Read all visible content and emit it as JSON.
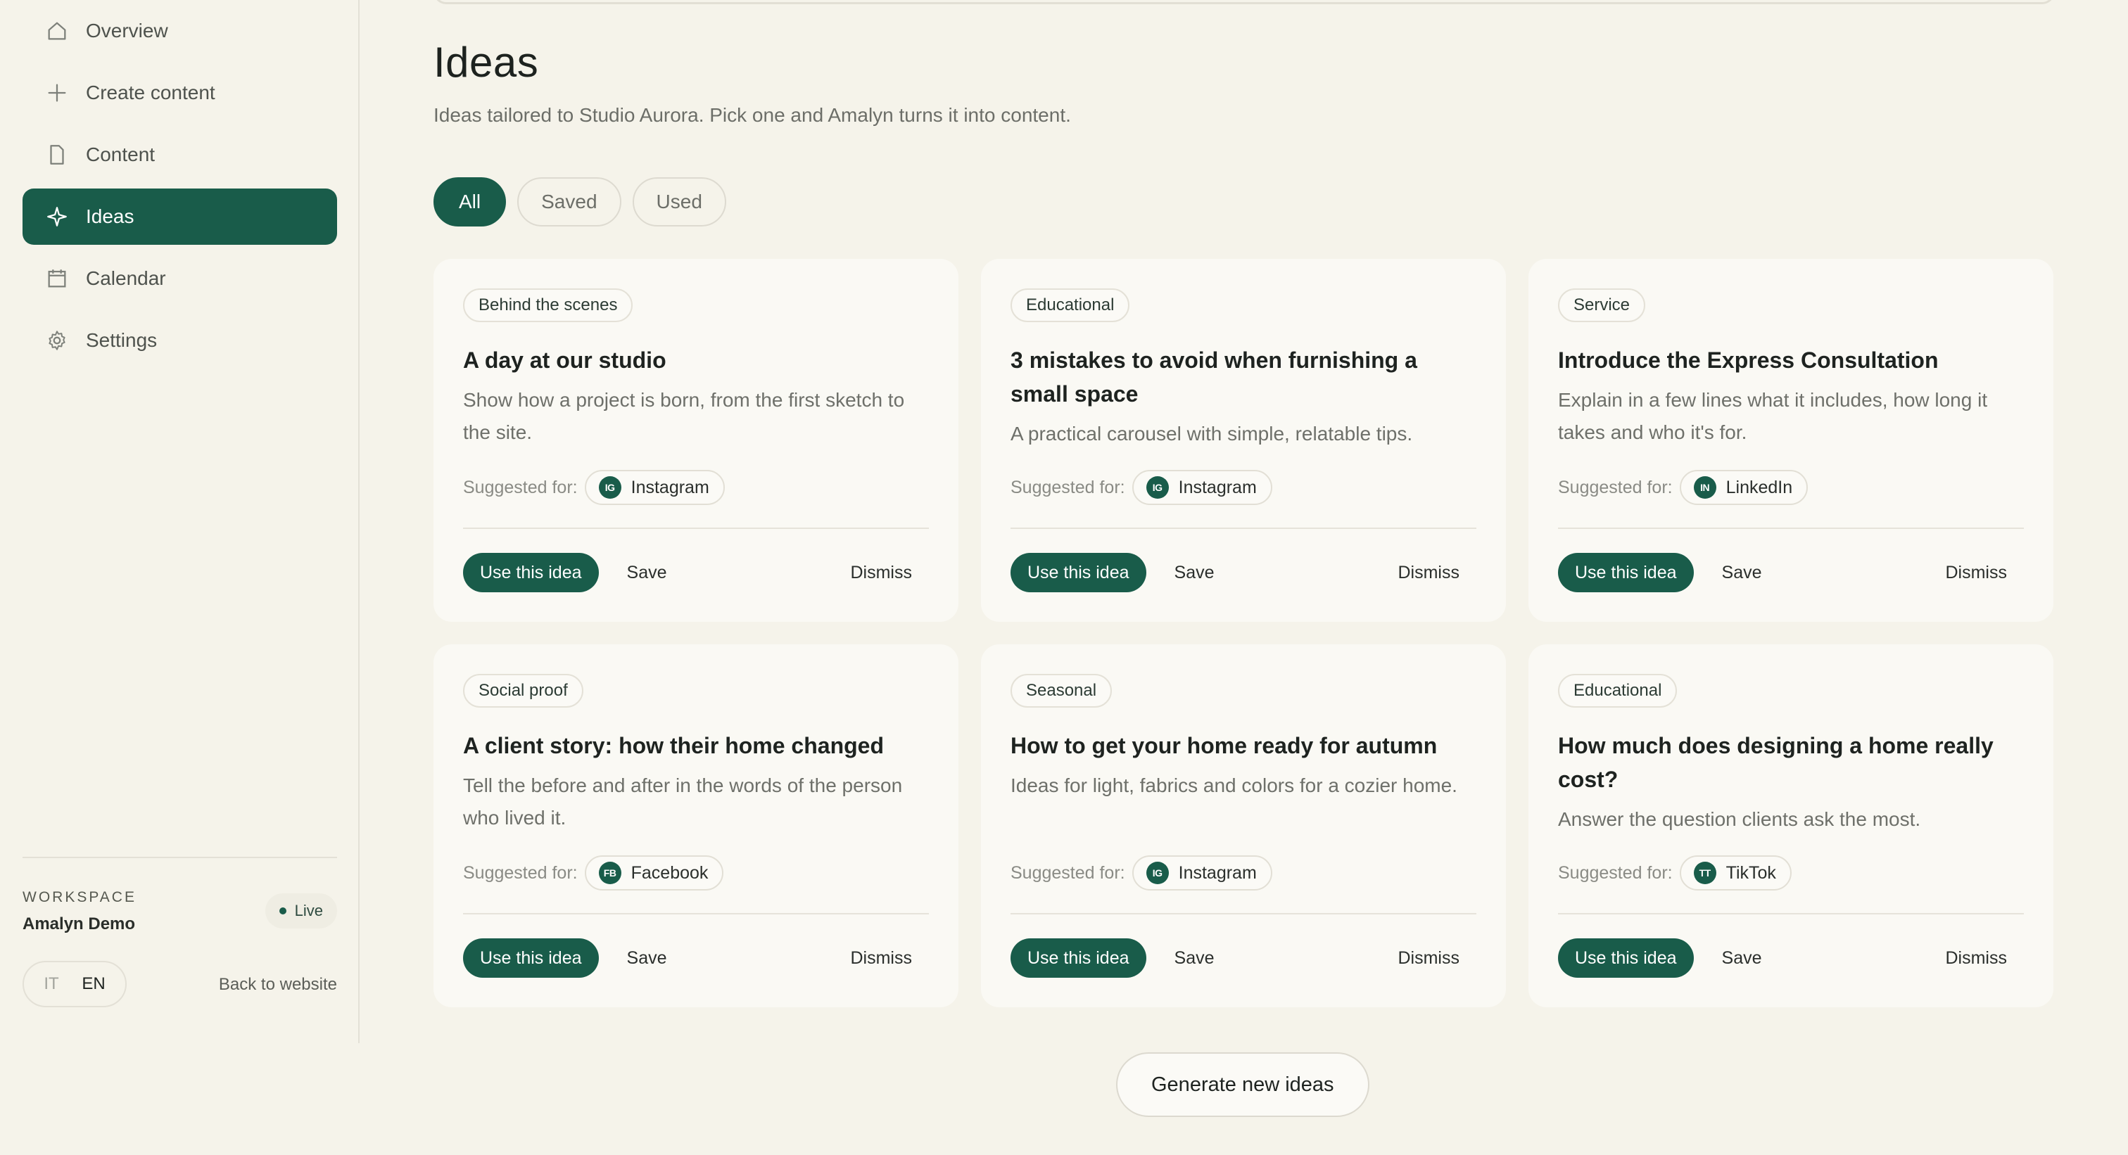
{
  "sidebar": {
    "items": [
      {
        "label": "Overview",
        "icon": "home-icon"
      },
      {
        "label": "Create content",
        "icon": "plus-icon"
      },
      {
        "label": "Content",
        "icon": "document-icon"
      },
      {
        "label": "Ideas",
        "icon": "sparkle-icon",
        "active": true
      },
      {
        "label": "Calendar",
        "icon": "calendar-icon"
      },
      {
        "label": "Settings",
        "icon": "gear-icon"
      }
    ],
    "workspace": {
      "label": "WORKSPACE",
      "name": "Amalyn Demo",
      "status": "Live"
    },
    "lang": {
      "it": "IT",
      "en": "EN",
      "selected": "EN"
    },
    "back_link": "Back to website"
  },
  "main": {
    "title": "Ideas",
    "subtitle": "Ideas tailored to Studio Aurora. Pick one and Amalyn turns it into content.",
    "filters": [
      "All",
      "Saved",
      "Used"
    ],
    "active_filter": "All",
    "suggested_label": "Suggested for:",
    "actions": {
      "use": "Use this idea",
      "save": "Save",
      "dismiss": "Dismiss"
    },
    "cards": [
      {
        "tag": "Behind the scenes",
        "title": "A day at our studio",
        "desc": "Show how a project is born, from the first sketch to the site.",
        "platform": "Instagram",
        "platform_abbr": "IG"
      },
      {
        "tag": "Educational",
        "title": "3 mistakes to avoid when furnishing a small space",
        "desc": "A practical carousel with simple, relatable tips.",
        "platform": "Instagram",
        "platform_abbr": "IG"
      },
      {
        "tag": "Service",
        "title": "Introduce the Express Consultation",
        "desc": "Explain in a few lines what it includes, how long it takes and who it's for.",
        "platform": "LinkedIn",
        "platform_abbr": "IN"
      },
      {
        "tag": "Social proof",
        "title": "A client story: how their home changed",
        "desc": "Tell the before and after in the words of the person who lived it.",
        "platform": "Facebook",
        "platform_abbr": "FB"
      },
      {
        "tag": "Seasonal",
        "title": "How to get your home ready for autumn",
        "desc": "Ideas for light, fabrics and colors for a cozier home.",
        "platform": "Instagram",
        "platform_abbr": "IG"
      },
      {
        "tag": "Educational",
        "title": "How much does designing a home really cost?",
        "desc": "Answer the question clients ask the most.",
        "platform": "TikTok",
        "platform_abbr": "TT"
      }
    ],
    "generate_button": "Generate new ideas"
  },
  "colors": {
    "accent": "#195c4a",
    "background": "#f5f3ea",
    "card": "#faf9f4"
  }
}
